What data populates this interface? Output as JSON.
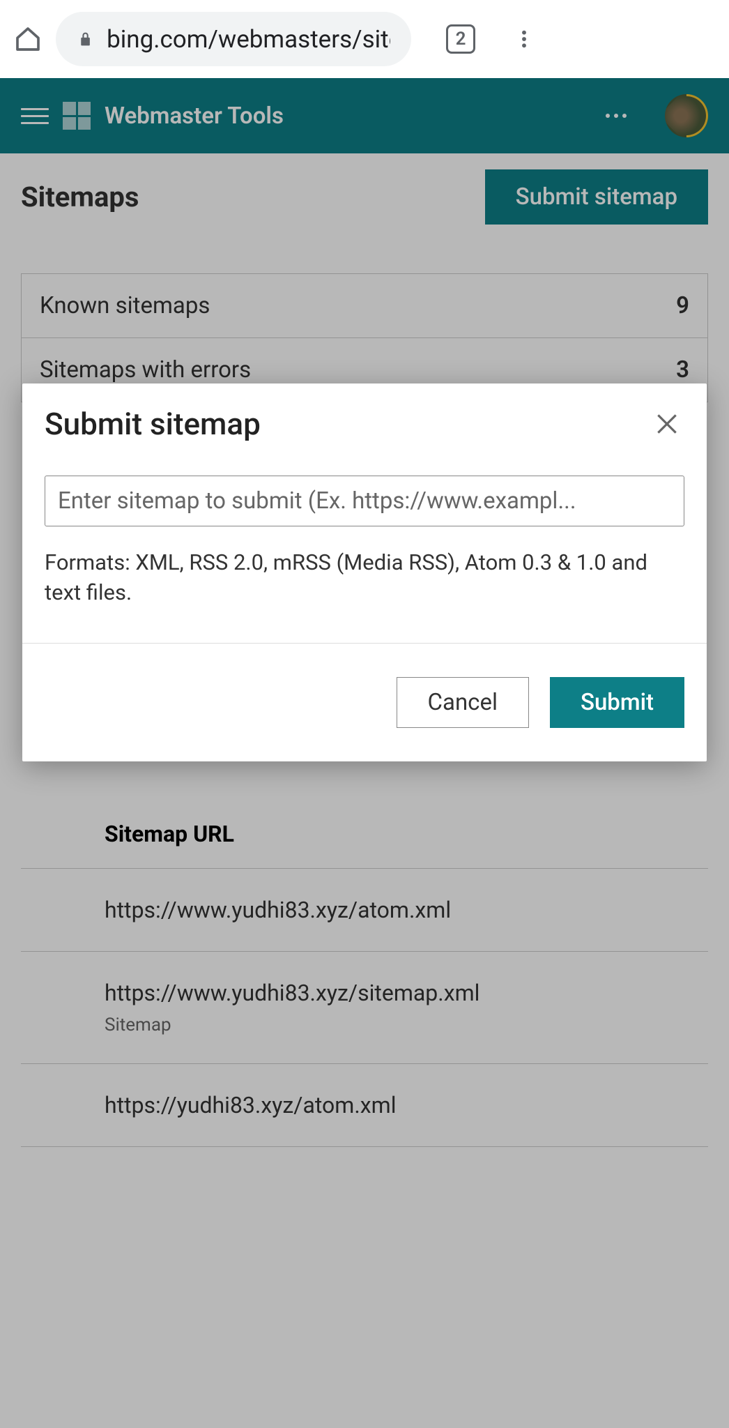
{
  "browser": {
    "url": "bing.com/webmasters/sitem",
    "tab_count": "2"
  },
  "header": {
    "app_title": "Webmaster Tools"
  },
  "page": {
    "title": "Sitemaps",
    "submit_button": "Submit sitemap"
  },
  "stats": [
    {
      "label": "Known sitemaps",
      "value": "9"
    },
    {
      "label": "Sitemaps with errors",
      "value": "3"
    }
  ],
  "table": {
    "header": "Sitemap URL",
    "rows": [
      {
        "url": "https://www.yudhi83.xyz/atom.xml",
        "sub": ""
      },
      {
        "url": "https://www.yudhi83.xyz/sitemap.xml",
        "sub": "Sitemap"
      },
      {
        "url": "https://yudhi83.xyz/atom.xml",
        "sub": ""
      }
    ]
  },
  "modal": {
    "title": "Submit sitemap",
    "placeholder": "Enter sitemap to submit (Ex. https://www.exampl...",
    "formats": "Formats: XML, RSS 2.0, mRSS (Media RSS), Atom 0.3 & 1.0 and text files.",
    "cancel": "Cancel",
    "submit": "Submit"
  }
}
